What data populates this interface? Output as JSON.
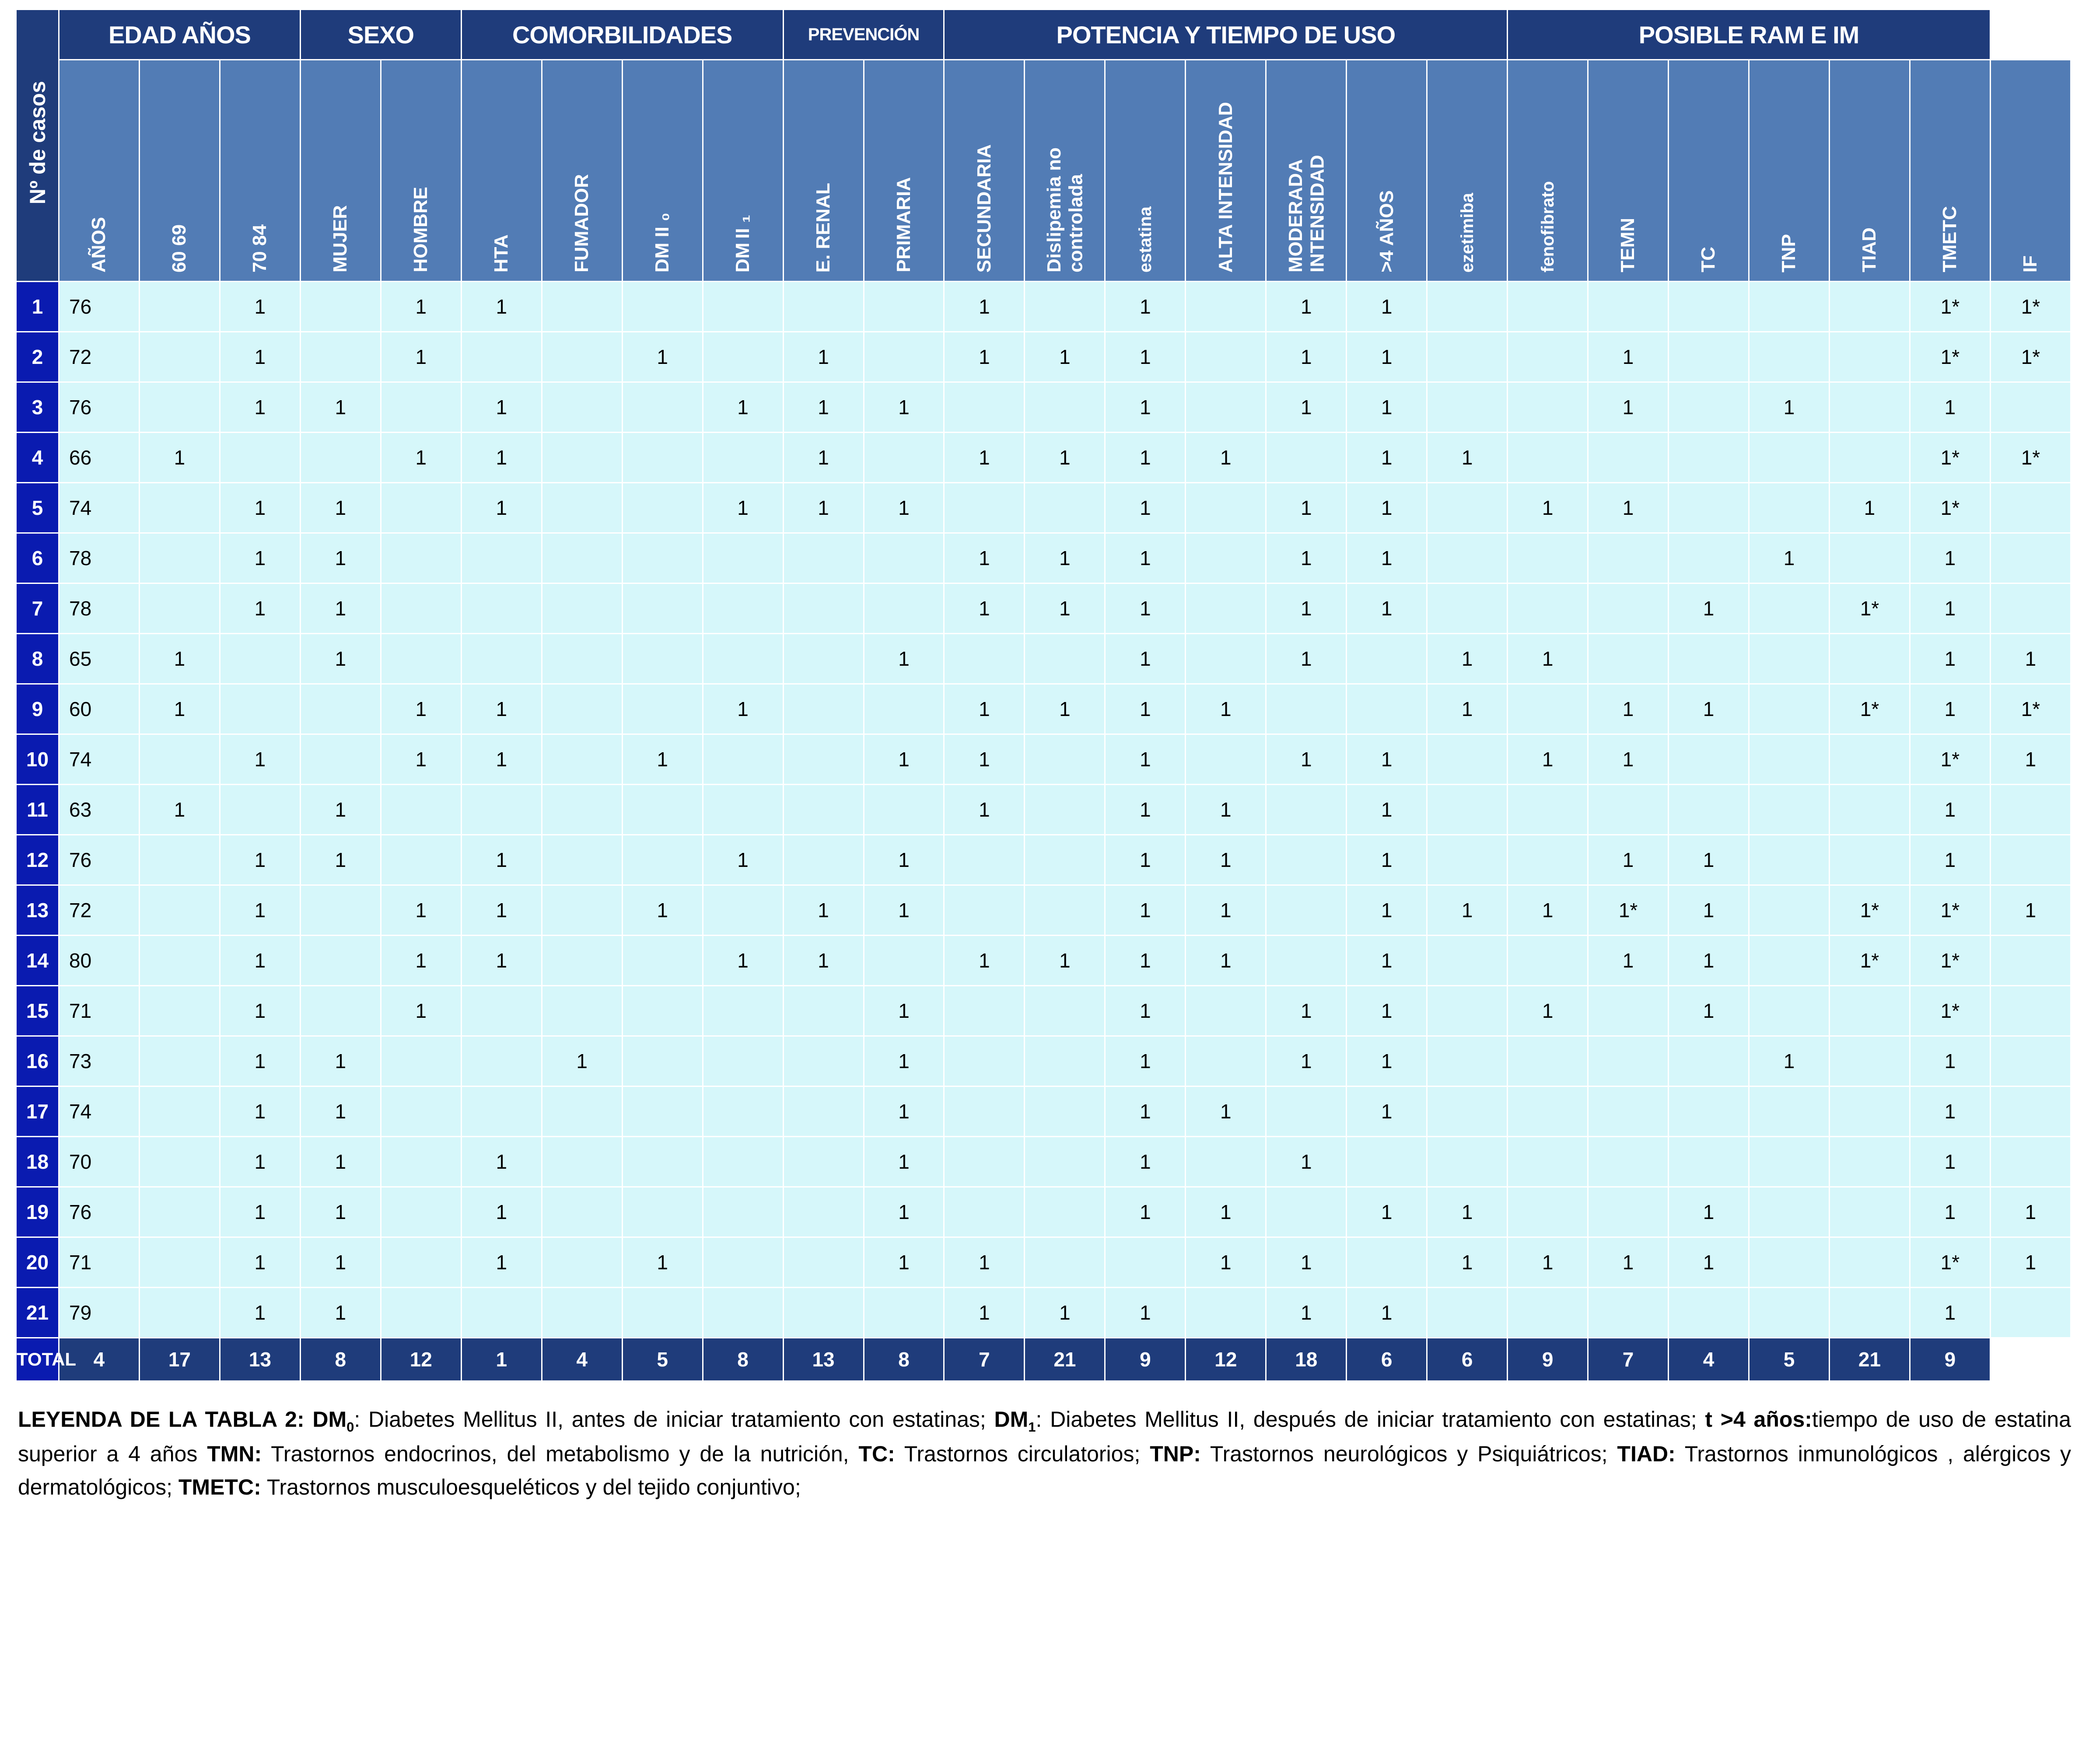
{
  "table": {
    "stub_label": "Nº de casos",
    "groups": [
      {
        "label": "EDAD AÑOS",
        "span": 3
      },
      {
        "label": "SEXO",
        "span": 2
      },
      {
        "label": "COMORBILIDADES",
        "span": 4
      },
      {
        "label": "PREVENCIÓN",
        "span": 2,
        "small": true
      },
      {
        "label": "POTENCIA Y TIEMPO DE USO",
        "span": 7
      },
      {
        "label": "POSIBLE RAM E IM",
        "span": 6
      }
    ],
    "columns": [
      {
        "key": "anos",
        "label": "AÑOS",
        "style": "one"
      },
      {
        "key": "e6069",
        "label": "60 69",
        "style": "one"
      },
      {
        "key": "e7084",
        "label": "70 84",
        "style": "one"
      },
      {
        "key": "mujer",
        "label": "MUJER",
        "style": "one"
      },
      {
        "key": "hombre",
        "label": "HOMBRE",
        "style": "one"
      },
      {
        "key": "hta",
        "label": "HTA",
        "style": "one"
      },
      {
        "key": "fumador",
        "label": "FUMADOR",
        "style": "one"
      },
      {
        "key": "dm2_0",
        "label": "DM II ₀",
        "style": "one"
      },
      {
        "key": "dm2_1",
        "label": "DM II ₁",
        "style": "one"
      },
      {
        "key": "erenal",
        "label": "E. RENAL",
        "style": "one"
      },
      {
        "key": "primaria",
        "label": "PRIMARIA",
        "style": "one"
      },
      {
        "key": "secundaria",
        "label": "SECUNDARIA",
        "style": "one"
      },
      {
        "key": "dislipemia",
        "label": "Dislipemia no controlada",
        "style": "two"
      },
      {
        "key": "estatina",
        "label": "estatina",
        "style": "thin"
      },
      {
        "key": "alta",
        "label": "ALTA INTENSIDAD",
        "style": "two"
      },
      {
        "key": "moderada",
        "label": "MODERADA INTENSIDAD",
        "style": "two"
      },
      {
        "key": "mas4anos",
        "label": ">4 AÑOS",
        "style": "one"
      },
      {
        "key": "ezetimiba",
        "label": "ezetimiba",
        "style": "thin"
      },
      {
        "key": "fenofibrato",
        "label": "fenofibrato",
        "style": "thin"
      },
      {
        "key": "temn",
        "label": "TEMN",
        "style": "one"
      },
      {
        "key": "tc",
        "label": "TC",
        "style": "one"
      },
      {
        "key": "tnp",
        "label": "TNP",
        "style": "one"
      },
      {
        "key": "tiad",
        "label": "TIAD",
        "style": "one"
      },
      {
        "key": "tmetc",
        "label": "TMETC",
        "style": "one"
      },
      {
        "key": "if",
        "label": "IF",
        "style": "one"
      }
    ],
    "rows": [
      {
        "n": "1",
        "cells": [
          "76",
          "",
          "1",
          "",
          "1",
          "1",
          "",
          "",
          "",
          "",
          "",
          "1",
          "",
          "1",
          "",
          "1",
          "1",
          "",
          "",
          "",
          "",
          "",
          "",
          "1*",
          "1*"
        ]
      },
      {
        "n": "2",
        "cells": [
          "72",
          "",
          "1",
          "",
          "1",
          "",
          "",
          "1",
          "",
          "1",
          "",
          "1",
          "1",
          "1",
          "",
          "1",
          "1",
          "",
          "",
          "1",
          "",
          "",
          "",
          "1*",
          "1*"
        ]
      },
      {
        "n": "3",
        "cells": [
          "76",
          "",
          "1",
          "1",
          "",
          "1",
          "",
          "",
          "1",
          "1",
          "1",
          "",
          "",
          "1",
          "",
          "1",
          "1",
          "",
          "",
          "1",
          "",
          "1",
          "",
          "1",
          ""
        ]
      },
      {
        "n": "4",
        "cells": [
          "66",
          "1",
          "",
          "",
          "1",
          "1",
          "",
          "",
          "",
          "1",
          "",
          "1",
          "1",
          "1",
          "1",
          "",
          "1",
          "1",
          "",
          "",
          "",
          "",
          "",
          "1*",
          "1*"
        ]
      },
      {
        "n": "5",
        "cells": [
          "74",
          "",
          "1",
          "1",
          "",
          "1",
          "",
          "",
          "1",
          "1",
          "1",
          "",
          "",
          "1",
          "",
          "1",
          "1",
          "",
          "1",
          "1",
          "",
          "",
          "1",
          "1*",
          ""
        ]
      },
      {
        "n": "6",
        "cells": [
          "78",
          "",
          "1",
          "1",
          "",
          "",
          "",
          "",
          "",
          "",
          "",
          "1",
          "1",
          "1",
          "",
          "1",
          "1",
          "",
          "",
          "",
          "",
          "1",
          "",
          "1",
          ""
        ]
      },
      {
        "n": "7",
        "cells": [
          "78",
          "",
          "1",
          "1",
          "",
          "",
          "",
          "",
          "",
          "",
          "",
          "1",
          "1",
          "1",
          "",
          "1",
          "1",
          "",
          "",
          "",
          "1",
          "",
          "1*",
          "1",
          ""
        ]
      },
      {
        "n": "8",
        "cells": [
          "65",
          "1",
          "",
          "1",
          "",
          "",
          "",
          "",
          "",
          "",
          "1",
          "",
          "",
          "1",
          "",
          "1",
          "",
          "1",
          "1",
          "",
          "",
          "",
          "",
          "1",
          "1"
        ]
      },
      {
        "n": "9",
        "cells": [
          "60",
          "1",
          "",
          "",
          "1",
          "1",
          "",
          "",
          "1",
          "",
          "",
          "1",
          "1",
          "1",
          "1",
          "",
          "",
          "1",
          "",
          "1",
          "1",
          "",
          "1*",
          "1",
          "1*"
        ]
      },
      {
        "n": "10",
        "cells": [
          "74",
          "",
          "1",
          "",
          "1",
          "1",
          "",
          "1",
          "",
          "",
          "1",
          "1",
          "",
          "1",
          "",
          "1",
          "1",
          "",
          "1",
          "1",
          "",
          "",
          "",
          "1*",
          "1"
        ]
      },
      {
        "n": "11",
        "cells": [
          "63",
          "1",
          "",
          "1",
          "",
          "",
          "",
          "",
          "",
          "",
          "",
          "1",
          "",
          "1",
          "1",
          "",
          "1",
          "",
          "",
          "",
          "",
          "",
          "",
          "1",
          ""
        ]
      },
      {
        "n": "12",
        "cells": [
          "76",
          "",
          "1",
          "1",
          "",
          "1",
          "",
          "",
          "1",
          "",
          "1",
          "",
          "",
          "1",
          "1",
          "",
          "1",
          "",
          "",
          "1",
          "1",
          "",
          "",
          "1",
          ""
        ]
      },
      {
        "n": "13",
        "cells": [
          "72",
          "",
          "1",
          "",
          "1",
          "1",
          "",
          "1",
          "",
          "1",
          "1",
          "",
          "",
          "1",
          "1",
          "",
          "1",
          "1",
          "1",
          "1*",
          "1",
          "",
          "1*",
          "1*",
          "1"
        ]
      },
      {
        "n": "14",
        "cells": [
          "80",
          "",
          "1",
          "",
          "1",
          "1",
          "",
          "",
          "1",
          "1",
          "",
          "1",
          "1",
          "1",
          "1",
          "",
          "1",
          "",
          "",
          "1",
          "1",
          "",
          "1*",
          "1*",
          ""
        ]
      },
      {
        "n": "15",
        "cells": [
          "71",
          "",
          "1",
          "",
          "1",
          "",
          "",
          "",
          "",
          "",
          "1",
          "",
          "",
          "1",
          "",
          "1",
          "1",
          "",
          "1",
          "",
          "1",
          "",
          "",
          "1*",
          ""
        ]
      },
      {
        "n": "16",
        "cells": [
          "73",
          "",
          "1",
          "1",
          "",
          "",
          "1",
          "",
          "",
          "",
          "1",
          "",
          "",
          "1",
          "",
          "1",
          "1",
          "",
          "",
          "",
          "",
          "1",
          "",
          "1",
          ""
        ]
      },
      {
        "n": "17",
        "cells": [
          "74",
          "",
          "1",
          "1",
          "",
          "",
          "",
          "",
          "",
          "",
          "1",
          "",
          "",
          "1",
          "1",
          "",
          "1",
          "",
          "",
          "",
          "",
          "",
          "",
          "1",
          ""
        ]
      },
      {
        "n": "18",
        "cells": [
          "70",
          "",
          "1",
          "1",
          "",
          "1",
          "",
          "",
          "",
          "",
          "1",
          "",
          "",
          "1",
          "",
          "1",
          "",
          "",
          "",
          "",
          "",
          "",
          "",
          "1",
          ""
        ]
      },
      {
        "n": "19",
        "cells": [
          "76",
          "",
          "1",
          "1",
          "",
          "1",
          "",
          "",
          "",
          "",
          "1",
          "",
          "",
          "1",
          "1",
          "",
          "1",
          "1",
          "",
          "",
          "1",
          "",
          "",
          "1",
          "1"
        ]
      },
      {
        "n": "20",
        "cells": [
          "71",
          "",
          "1",
          "1",
          "",
          "1",
          "",
          "1",
          "",
          "",
          "1",
          "1",
          "",
          "",
          "1",
          "1",
          "",
          "1",
          "1",
          "1",
          "1",
          "",
          "",
          "1*",
          "1"
        ]
      },
      {
        "n": "21",
        "cells": [
          "79",
          "",
          "1",
          "1",
          "",
          "",
          "",
          "",
          "",
          "",
          "",
          "1",
          "1",
          "1",
          "",
          "1",
          "1",
          "",
          "",
          "",
          "",
          "",
          "",
          "1",
          ""
        ]
      }
    ],
    "total": {
      "label": "TOTAL",
      "values": [
        "4",
        "17",
        "13",
        "8",
        "12",
        "1",
        "4",
        "5",
        "8",
        "13",
        "8",
        "7",
        "21",
        "9",
        "12",
        "18",
        "6",
        "6",
        "9",
        "7",
        "4",
        "5",
        "21",
        "9"
      ]
    }
  },
  "legend": {
    "title": "LEYENDA DE LA TABLA 2:",
    "dm0_key": "DM",
    "dm0_sub": "0",
    "dm0_text": ": Diabetes Mellitus II, antes de iniciar tratamiento con estatinas;",
    "dm1_key": "DM",
    "dm1_sub": "1",
    "dm1_text": ": Diabetes Mellitus II, después de iniciar tratamiento con estatinas;",
    "t4_key": "t >4 años:",
    "t4_text": "tiempo de uso de estatina superior a 4 años",
    "tmn_key": "TMN:",
    "tmn_text": "Trastornos endocrinos, del metabolismo y de la nutrición,",
    "tc_key": "TC:",
    "tc_text": "Trastornos circulatorios;",
    "tnp_key": "TNP:",
    "tnp_text": "Trastornos  neurológicos y Psiquiátricos;",
    "tiad_key": "TIAD:",
    "tiad_text": "Trastornos inmunológicos , alérgicos y dermatológicos;",
    "tmetc_key": "TMETC:",
    "tmetc_text": "Trastornos musculoesqueléticos y del tejido conjuntivo;"
  },
  "colors": {
    "group_band": "#1F3C7B",
    "col_header": "#527CB5",
    "data_cell": "#D6F7FA",
    "index_cell": "#0A1BB0",
    "total_band": "#1F3C7B"
  }
}
